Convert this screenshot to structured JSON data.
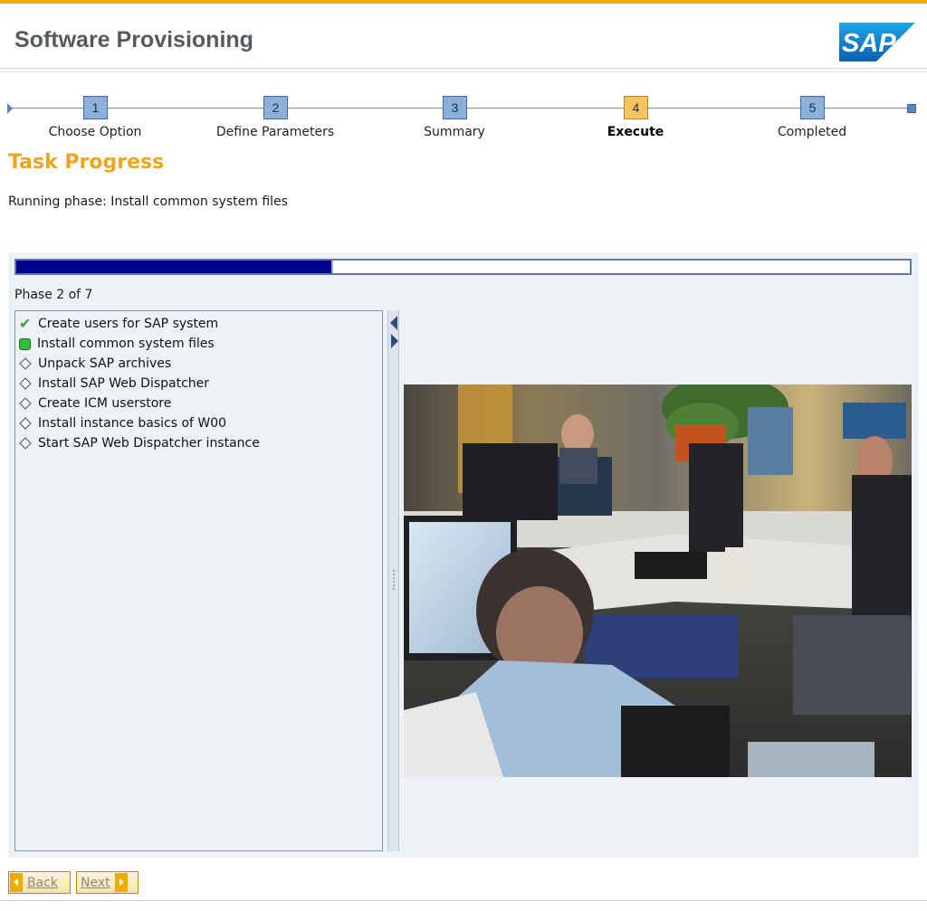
{
  "header": {
    "title": "Software Provisioning",
    "logo_text": "SAP"
  },
  "roadmap": {
    "steps": [
      {
        "number": "1",
        "label": "Choose Option"
      },
      {
        "number": "2",
        "label": "Define Parameters"
      },
      {
        "number": "3",
        "label": "Summary"
      },
      {
        "number": "4",
        "label": "Execute"
      },
      {
        "number": "5",
        "label": "Completed"
      }
    ],
    "active_step": 4
  },
  "main": {
    "section_title": "Task Progress",
    "running_phase": "Running phase: Install common system files",
    "progress_fraction": 0.355,
    "phase_count": "Phase 2 of 7",
    "tasks": [
      {
        "label": "Create users for SAP system",
        "status": "done"
      },
      {
        "label": "Install common system files",
        "status": "running"
      },
      {
        "label": "Unpack SAP archives",
        "status": "pending"
      },
      {
        "label": "Install SAP Web Dispatcher",
        "status": "pending"
      },
      {
        "label": "Create ICM userstore",
        "status": "pending"
      },
      {
        "label": "Install instance basics of W00",
        "status": "pending"
      },
      {
        "label": "Start SAP Web Dispatcher instance",
        "status": "pending"
      }
    ]
  },
  "footer": {
    "back_label": "Back",
    "next_label": "Next"
  },
  "colors": {
    "accent": "#f0ab00",
    "progress": "#00008f",
    "step": "#8bb0d9",
    "step_active": "#f7c35a"
  },
  "icons": {
    "done": "checkmark-icon",
    "running": "green-square-icon",
    "pending": "diamond-icon"
  }
}
